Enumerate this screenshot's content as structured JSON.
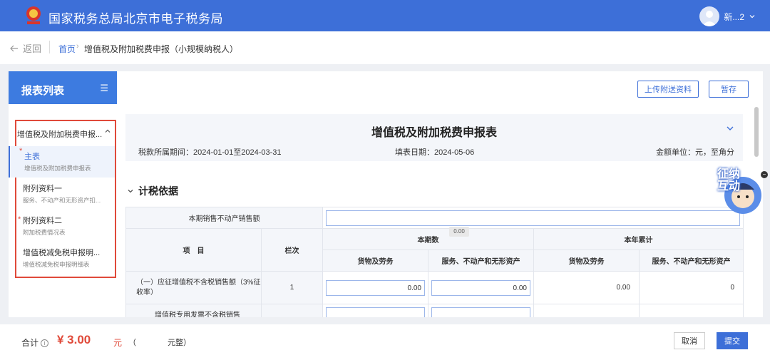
{
  "header": {
    "title": "国家税务总局北京市电子税务局",
    "user": "新...2"
  },
  "breadcrumb": {
    "back": "返回",
    "home": "首页",
    "sep": "›",
    "current": "增值税及附加税费申报（小规模纳税人）"
  },
  "sidebar": {
    "title": "报表列表",
    "menu_icon": "☰",
    "group": {
      "label": "增值税及附加税费申报...",
      "chevron": "^"
    },
    "items": [
      {
        "name": "主表",
        "sub": "增值税及附加税费申报表",
        "required": "*"
      },
      {
        "name": "附列资料一",
        "sub": "服务、不动产和无形资产扣..."
      },
      {
        "name": "附列资料二",
        "sub": "附加税费情况表",
        "required": "*"
      },
      {
        "name": "增值税减免税申报明...",
        "sub": "增值税减免税申报明细表"
      }
    ]
  },
  "toolbar": {
    "upload": "上传附送资料",
    "save": "暂存"
  },
  "form": {
    "title": "增值税及附加税费申报表",
    "period": "税款所属期间：2024-01-01至2024-03-31",
    "fill_date": "填表日期：2024-05-06",
    "unit": "金额单位：元，至角分"
  },
  "section": {
    "title": "计税依据"
  },
  "table": {
    "row_sale_label": "本期销售不动产销售额",
    "tooltip": "0.00",
    "h_item": "项　目",
    "h_col": "栏次",
    "h_current": "本期数",
    "h_ytd": "本年累计",
    "h_goods": "货物及劳务",
    "h_services": "服务、不动产和无形资产",
    "row1_label": "（一）应征增值税不含税销售额（3%征收率）",
    "row1_col": "1",
    "row1_cur_goods": "0.00",
    "row1_cur_services": "0.00",
    "row1_ytd_goods": "0.00",
    "row1_ytd_services": "0",
    "row2_label": "增值税专用发票不含税销售"
  },
  "float": {
    "text": "征纳互动"
  },
  "footer": {
    "total_label": "合计",
    "info": "i",
    "amount": "¥ 3.00",
    "currency": "元",
    "chinese_amount": "（　　　　元整）",
    "cancel": "取消",
    "submit": "提交"
  },
  "colors": {
    "primary": "#3d6fd8",
    "danger": "#e04a3a"
  }
}
